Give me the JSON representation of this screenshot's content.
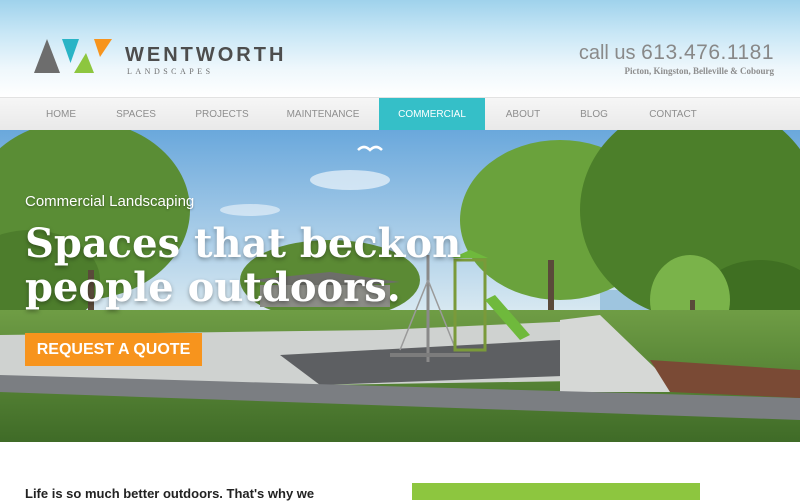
{
  "brand": {
    "name": "WENTWORTH",
    "tagline": "LANDSCAPES"
  },
  "contact": {
    "phone_prefix": "call us",
    "phone_number": "613.476.1181",
    "locations": "Picton, Kingston, Belleville & Cobourg"
  },
  "nav": {
    "items": [
      {
        "label": "HOME"
      },
      {
        "label": "SPACES"
      },
      {
        "label": "PROJECTS"
      },
      {
        "label": "MAINTENANCE"
      },
      {
        "label": "COMMERCIAL"
      },
      {
        "label": "ABOUT"
      },
      {
        "label": "BLOG"
      },
      {
        "label": "CONTACT"
      }
    ],
    "active": "COMMERCIAL"
  },
  "hero": {
    "subtitle": "Commercial Landscaping",
    "title_line1": "Spaces that beckon",
    "title_line2": "people outdoors.",
    "cta_label": "REQUEST A QUOTE"
  },
  "intro": {
    "text": "Life is so much better outdoors. That's why we"
  },
  "colors": {
    "accent_teal": "#35bfc8",
    "cta_orange": "#f7941d",
    "logo_green": "#8dc63f",
    "logo_gray": "#6d6d6d"
  }
}
